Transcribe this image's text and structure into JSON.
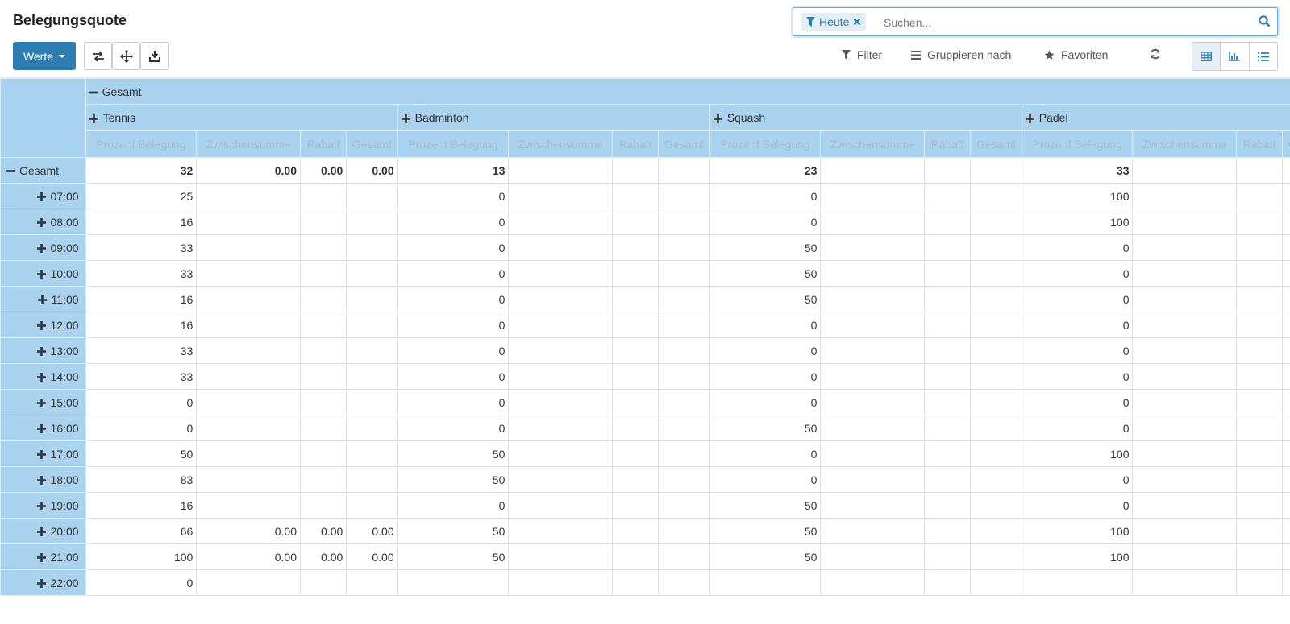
{
  "header": {
    "title": "Belegungsquote",
    "measures_label": "Werte"
  },
  "search": {
    "facet_label": "Heute",
    "placeholder": "Suchen..."
  },
  "menus": {
    "filter_label": "Filter",
    "group_label": "Gruppieren nach",
    "favorites_label": "Favoriten"
  },
  "pivot": {
    "total_label": "Gesamt",
    "sports": [
      "Tennis",
      "Badminton",
      "Squash",
      "Padel"
    ],
    "measures": [
      "Prozent Belegung",
      "Zwischensumme",
      "Rabatt",
      "Gesamt"
    ],
    "rows": [
      {
        "label": "Gesamt",
        "cells": [
          "32",
          "0.00",
          "0.00",
          "0.00",
          "13",
          "",
          "",
          "",
          "23",
          "",
          "",
          "",
          "33",
          "",
          "",
          ""
        ]
      },
      {
        "label": "07:00",
        "cells": [
          "25",
          "",
          "",
          "",
          "0",
          "",
          "",
          "",
          "0",
          "",
          "",
          "",
          "100",
          "",
          "",
          ""
        ]
      },
      {
        "label": "08:00",
        "cells": [
          "16",
          "",
          "",
          "",
          "0",
          "",
          "",
          "",
          "0",
          "",
          "",
          "",
          "100",
          "",
          "",
          ""
        ]
      },
      {
        "label": "09:00",
        "cells": [
          "33",
          "",
          "",
          "",
          "0",
          "",
          "",
          "",
          "50",
          "",
          "",
          "",
          "0",
          "",
          "",
          ""
        ]
      },
      {
        "label": "10:00",
        "cells": [
          "33",
          "",
          "",
          "",
          "0",
          "",
          "",
          "",
          "50",
          "",
          "",
          "",
          "0",
          "",
          "",
          ""
        ]
      },
      {
        "label": "11:00",
        "cells": [
          "16",
          "",
          "",
          "",
          "0",
          "",
          "",
          "",
          "50",
          "",
          "",
          "",
          "0",
          "",
          "",
          ""
        ]
      },
      {
        "label": "12:00",
        "cells": [
          "16",
          "",
          "",
          "",
          "0",
          "",
          "",
          "",
          "0",
          "",
          "",
          "",
          "0",
          "",
          "",
          ""
        ]
      },
      {
        "label": "13:00",
        "cells": [
          "33",
          "",
          "",
          "",
          "0",
          "",
          "",
          "",
          "0",
          "",
          "",
          "",
          "0",
          "",
          "",
          ""
        ]
      },
      {
        "label": "14:00",
        "cells": [
          "33",
          "",
          "",
          "",
          "0",
          "",
          "",
          "",
          "0",
          "",
          "",
          "",
          "0",
          "",
          "",
          ""
        ]
      },
      {
        "label": "15:00",
        "cells": [
          "0",
          "",
          "",
          "",
          "0",
          "",
          "",
          "",
          "0",
          "",
          "",
          "",
          "0",
          "",
          "",
          ""
        ]
      },
      {
        "label": "16:00",
        "cells": [
          "0",
          "",
          "",
          "",
          "0",
          "",
          "",
          "",
          "50",
          "",
          "",
          "",
          "0",
          "",
          "",
          ""
        ]
      },
      {
        "label": "17:00",
        "cells": [
          "50",
          "",
          "",
          "",
          "50",
          "",
          "",
          "",
          "0",
          "",
          "",
          "",
          "100",
          "",
          "",
          ""
        ]
      },
      {
        "label": "18:00",
        "cells": [
          "83",
          "",
          "",
          "",
          "50",
          "",
          "",
          "",
          "0",
          "",
          "",
          "",
          "0",
          "",
          "",
          ""
        ]
      },
      {
        "label": "19:00",
        "cells": [
          "16",
          "",
          "",
          "",
          "0",
          "",
          "",
          "",
          "50",
          "",
          "",
          "",
          "0",
          "",
          "",
          ""
        ]
      },
      {
        "label": "20:00",
        "cells": [
          "66",
          "0.00",
          "0.00",
          "0.00",
          "50",
          "",
          "",
          "",
          "50",
          "",
          "",
          "",
          "100",
          "",
          "",
          ""
        ]
      },
      {
        "label": "21:00",
        "cells": [
          "100",
          "0.00",
          "0.00",
          "0.00",
          "50",
          "",
          "",
          "",
          "50",
          "",
          "",
          "",
          "100",
          "",
          "",
          ""
        ]
      },
      {
        "label": "22:00",
        "cells": [
          "0",
          "",
          "",
          "",
          "",
          "",
          "",
          "",
          "",
          "",
          "",
          "",
          "",
          "",
          "",
          ""
        ]
      }
    ]
  }
}
